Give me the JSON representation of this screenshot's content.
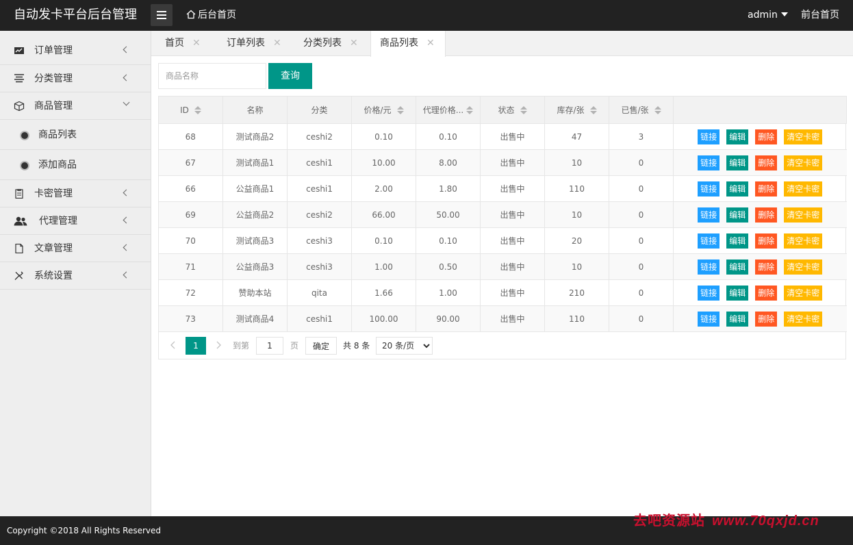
{
  "header": {
    "logo": "自动发卡平台后台管理",
    "home_link": "后台首页",
    "user": "admin",
    "front_link": "前台首页"
  },
  "sidebar": {
    "items": [
      {
        "label": "订单管理",
        "icon": "chart-icon"
      },
      {
        "label": "分类管理",
        "icon": "list-icon"
      },
      {
        "label": "商品管理",
        "icon": "box-icon",
        "expanded": true,
        "children": [
          {
            "label": "商品列表"
          },
          {
            "label": "添加商品"
          }
        ]
      },
      {
        "label": "卡密管理",
        "icon": "clipboard-icon"
      },
      {
        "label": "代理管理",
        "icon": "users-icon"
      },
      {
        "label": "文章管理",
        "icon": "file-icon"
      },
      {
        "label": "系统设置",
        "icon": "tools-icon"
      }
    ]
  },
  "tabs": [
    {
      "label": "首页"
    },
    {
      "label": "订单列表"
    },
    {
      "label": "分类列表"
    },
    {
      "label": "商品列表",
      "active": true
    }
  ],
  "search": {
    "placeholder": "商品名称",
    "button": "查询"
  },
  "table": {
    "columns": [
      "ID",
      "名称",
      "分类",
      "价格/元",
      "代理价格...",
      "状态",
      "库存/张",
      "已售/张"
    ],
    "actions": [
      "链接",
      "编辑",
      "删除",
      "清空卡密"
    ],
    "rows": [
      [
        "68",
        "测试商品2",
        "ceshi2",
        "0.10",
        "0.10",
        "出售中",
        "47",
        "3"
      ],
      [
        "67",
        "测试商品1",
        "ceshi1",
        "10.00",
        "8.00",
        "出售中",
        "10",
        "0"
      ],
      [
        "66",
        "公益商品1",
        "ceshi1",
        "2.00",
        "1.80",
        "出售中",
        "110",
        "0"
      ],
      [
        "69",
        "公益商品2",
        "ceshi2",
        "66.00",
        "50.00",
        "出售中",
        "10",
        "0"
      ],
      [
        "70",
        "测试商品3",
        "ceshi3",
        "0.10",
        "0.10",
        "出售中",
        "20",
        "0"
      ],
      [
        "71",
        "公益商品3",
        "ceshi3",
        "1.00",
        "0.50",
        "出售中",
        "10",
        "0"
      ],
      [
        "72",
        "赞助本站",
        "qita",
        "1.66",
        "1.00",
        "出售中",
        "210",
        "0"
      ],
      [
        "73",
        "测试商品4",
        "ceshi1",
        "100.00",
        "90.00",
        "出售中",
        "110",
        "0"
      ]
    ]
  },
  "pager": {
    "current": "1",
    "goto_label": "到第",
    "goto_value": "1",
    "page_label": "页",
    "confirm": "确定",
    "total": "共 8 条",
    "page_size": "20 条/页"
  },
  "footer": {
    "copyright": "Copyright ©2018 All Rights Reserved",
    "watermark_cn": "去吧资源站",
    "watermark_url": "www.70qxjd.cn"
  },
  "colors": {
    "accent": "#009688",
    "link": "#1e9fff",
    "danger": "#ff5722",
    "warn": "#ffb800",
    "header": "#222222"
  }
}
